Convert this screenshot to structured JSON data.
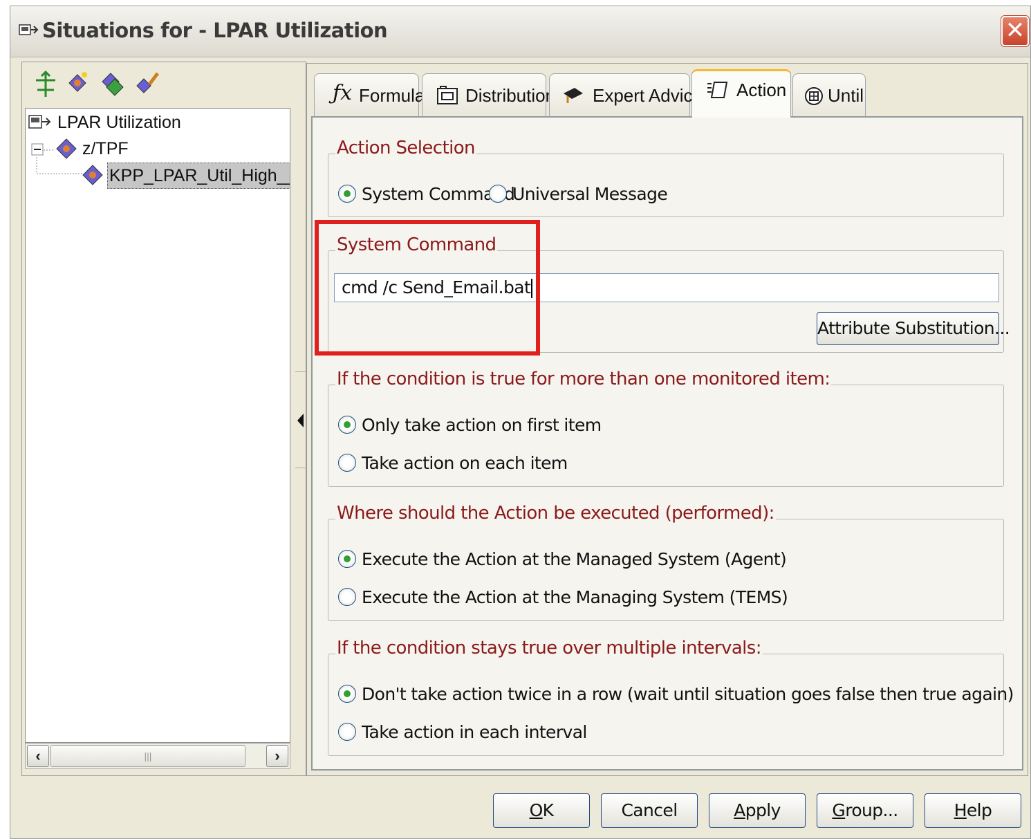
{
  "window": {
    "title": "Situations for - LPAR Utilization",
    "close_label": "✕"
  },
  "tree": {
    "root": "LPAR Utilization",
    "child": "z/TPF",
    "leaf": "KPP_LPAR_Util_High__San"
  },
  "scrollbar": {
    "left": "‹",
    "thumb": "|||",
    "right": "›"
  },
  "tabs": [
    {
      "label": "Formula"
    },
    {
      "label": "Distribution"
    },
    {
      "label": "Expert Advice"
    },
    {
      "label": "Action"
    },
    {
      "label": "Until"
    }
  ],
  "action_selection": {
    "title": "Action Selection",
    "options": [
      "System Command",
      "Universal Message"
    ],
    "selected": "System Command"
  },
  "system_command": {
    "title": "System Command",
    "value": "cmd /c Send_Email.bat",
    "attr_button": "Attribute Substitution..."
  },
  "multi_item": {
    "title": "If the condition is true for more than one monitored item:",
    "options": [
      "Only take action on first item",
      "Take action on each item"
    ]
  },
  "execute_where": {
    "title": "Where should the Action be executed (performed):",
    "options": [
      "Execute the Action at the Managed System (Agent)",
      "Execute the Action at the Managing System (TEMS)"
    ]
  },
  "intervals": {
    "title": "If the condition stays true over multiple intervals:",
    "options": [
      "Don't take action twice in a row (wait until situation goes false then true again)",
      "Take action in each interval"
    ]
  },
  "buttons": {
    "ok": {
      "mnemonic": "O",
      "rest": "K"
    },
    "cancel": "Cancel",
    "apply": {
      "mnemonic": "A",
      "rest": "pply"
    },
    "group": {
      "mnemonic": "G",
      "rest": "roup..."
    },
    "help": {
      "mnemonic": "H",
      "rest": "elp"
    }
  },
  "colors": {
    "group_title": "#8b1a1a",
    "highlight": "#e0201c",
    "radio_check": "#30a030"
  }
}
